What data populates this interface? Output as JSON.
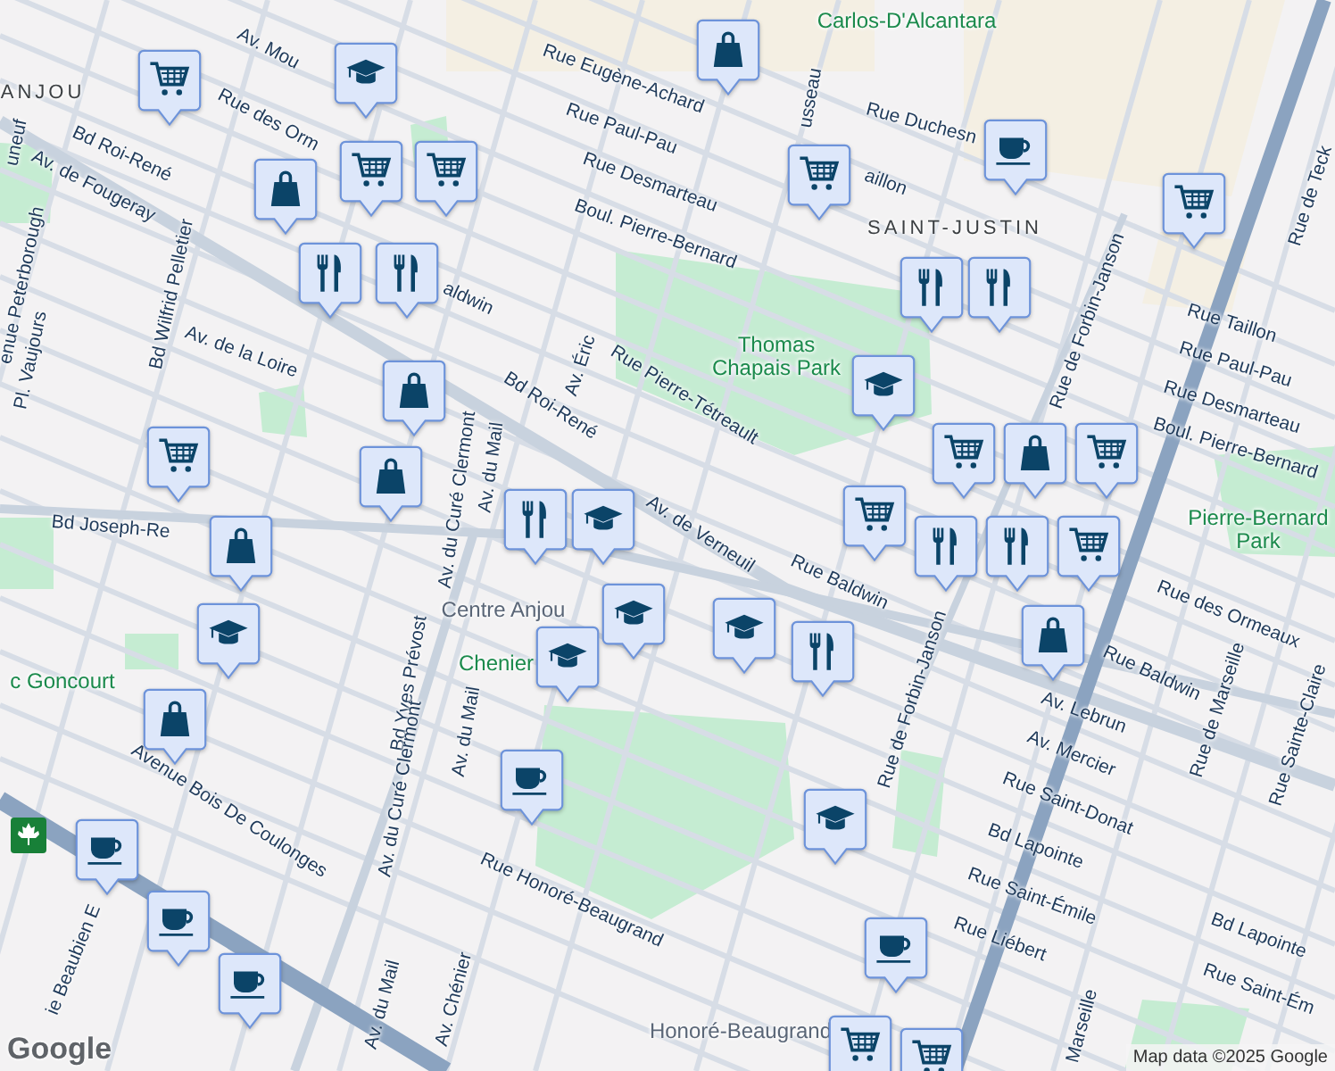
{
  "map": {
    "labels": [
      {
        "text": "Carlos-D'Alcantara",
        "kind": "park"
      },
      {
        "text": "ANJOU",
        "kind": "district"
      },
      {
        "text": "Av. Mou",
        "kind": "street"
      },
      {
        "text": "Rue des Orm",
        "kind": "street"
      },
      {
        "text": "uneuf",
        "kind": "street"
      },
      {
        "text": "Bd Roi-René",
        "kind": "street"
      },
      {
        "text": "Av. de Fougeray",
        "kind": "street"
      },
      {
        "text": "enue Peterborough",
        "kind": "street"
      },
      {
        "text": "Pl. Vaujours",
        "kind": "street"
      },
      {
        "text": "Bd Wilfrid Pelletier",
        "kind": "street"
      },
      {
        "text": "Av. de la Loire",
        "kind": "street"
      },
      {
        "text": "aldwin",
        "kind": "street"
      },
      {
        "text": "Rue Eugène-Achard",
        "kind": "street"
      },
      {
        "text": "Rue Paul-Pau",
        "kind": "street"
      },
      {
        "text": "Rue Desmarteau",
        "kind": "street"
      },
      {
        "text": "Boul. Pierre-Bernard",
        "kind": "street"
      },
      {
        "text": "usseau",
        "kind": "street"
      },
      {
        "text": "aillon",
        "kind": "street"
      },
      {
        "text": "Rue Duchesn",
        "kind": "street"
      },
      {
        "text": "SAINT-JUSTIN",
        "kind": "district"
      },
      {
        "text": "Thomas Chapais Park",
        "kind": "park"
      },
      {
        "text": "Av. Éric",
        "kind": "street"
      },
      {
        "text": "Rue Pierre-Tétreault",
        "kind": "street"
      },
      {
        "text": "Bd Roi-René",
        "kind": "street"
      },
      {
        "text": "Av. du Curé Clermont",
        "kind": "street"
      },
      {
        "text": "Av. du Mail",
        "kind": "street"
      },
      {
        "text": "Av. de Verneuil",
        "kind": "street"
      },
      {
        "text": "Rue de Forbin-Janson",
        "kind": "street"
      },
      {
        "text": "Rue de Teck",
        "kind": "street"
      },
      {
        "text": "Rue Taillon",
        "kind": "street"
      },
      {
        "text": "Rue Paul-Pau",
        "kind": "street"
      },
      {
        "text": "Rue Desmarteau",
        "kind": "street"
      },
      {
        "text": "Boul. Pierre-Bernard",
        "kind": "street"
      },
      {
        "text": "Pierre-Bernard Park",
        "kind": "park"
      },
      {
        "text": "Bd Joseph-Re",
        "kind": "street"
      },
      {
        "text": "Rue Baldwin",
        "kind": "street"
      },
      {
        "text": "Rue des Ormeaux",
        "kind": "street"
      },
      {
        "text": "Rue de Forbin-Janson",
        "kind": "street"
      },
      {
        "text": "Centre Anjou",
        "kind": "place"
      },
      {
        "text": "Chenier",
        "kind": "park"
      },
      {
        "text": "c Goncourt",
        "kind": "park"
      },
      {
        "text": "Bd Yves Prévost",
        "kind": "street"
      },
      {
        "text": "Rue Baldwin",
        "kind": "street"
      },
      {
        "text": "Av. Lebrun",
        "kind": "street"
      },
      {
        "text": "Av. Mercier",
        "kind": "street"
      },
      {
        "text": "Rue Saint-Donat",
        "kind": "street"
      },
      {
        "text": "Rue de Marseille",
        "kind": "street"
      },
      {
        "text": "Rue Sainte-Claire",
        "kind": "street"
      },
      {
        "text": "Av. du Curé Clermont",
        "kind": "street"
      },
      {
        "text": "Av. du Mail",
        "kind": "street"
      },
      {
        "text": "Avenue Bois De Coulonges",
        "kind": "street"
      },
      {
        "text": "Bd Lapointe",
        "kind": "street"
      },
      {
        "text": "Rue Saint-Émile",
        "kind": "street"
      },
      {
        "text": "Rue Liébert",
        "kind": "street"
      },
      {
        "text": "Rue Honoré-Beaugrand",
        "kind": "street"
      },
      {
        "text": "Av. du Mail",
        "kind": "street"
      },
      {
        "text": "ie Beaubien E",
        "kind": "street"
      },
      {
        "text": "Bd Lapointe",
        "kind": "street"
      },
      {
        "text": "Rue Saint-Ém",
        "kind": "street"
      },
      {
        "text": "Av. Chénier",
        "kind": "street"
      },
      {
        "text": "Honoré-Beaugrand",
        "kind": "place"
      },
      {
        "text": "Marseille",
        "kind": "street"
      }
    ],
    "pins": [
      {
        "kind": "bag"
      },
      {
        "kind": "cart"
      },
      {
        "kind": "cap"
      },
      {
        "kind": "bag"
      },
      {
        "kind": "cart"
      },
      {
        "kind": "cart"
      },
      {
        "kind": "cutlery"
      },
      {
        "kind": "cutlery"
      },
      {
        "kind": "cart"
      },
      {
        "kind": "cup"
      },
      {
        "kind": "cart"
      },
      {
        "kind": "cutlery"
      },
      {
        "kind": "cutlery"
      },
      {
        "kind": "cap"
      },
      {
        "kind": "bag"
      },
      {
        "kind": "bag"
      },
      {
        "kind": "cart"
      },
      {
        "kind": "bag"
      },
      {
        "kind": "cart"
      },
      {
        "kind": "bag"
      },
      {
        "kind": "cart"
      },
      {
        "kind": "cutlery"
      },
      {
        "kind": "cart"
      },
      {
        "kind": "cart"
      },
      {
        "kind": "cutlery"
      },
      {
        "kind": "cutlery"
      },
      {
        "kind": "cap"
      },
      {
        "kind": "cap"
      },
      {
        "kind": "bag"
      },
      {
        "kind": "cap"
      },
      {
        "kind": "cap"
      },
      {
        "kind": "cap"
      },
      {
        "kind": "cutlery"
      },
      {
        "kind": "bag"
      },
      {
        "kind": "cup"
      },
      {
        "kind": "cap"
      },
      {
        "kind": "cup"
      },
      {
        "kind": "cup"
      },
      {
        "kind": "cup"
      },
      {
        "kind": "cup"
      },
      {
        "kind": "cart"
      },
      {
        "kind": "cart"
      }
    ]
  },
  "attribution": {
    "logo": "Google",
    "text": "Map data ©2025 Google"
  }
}
